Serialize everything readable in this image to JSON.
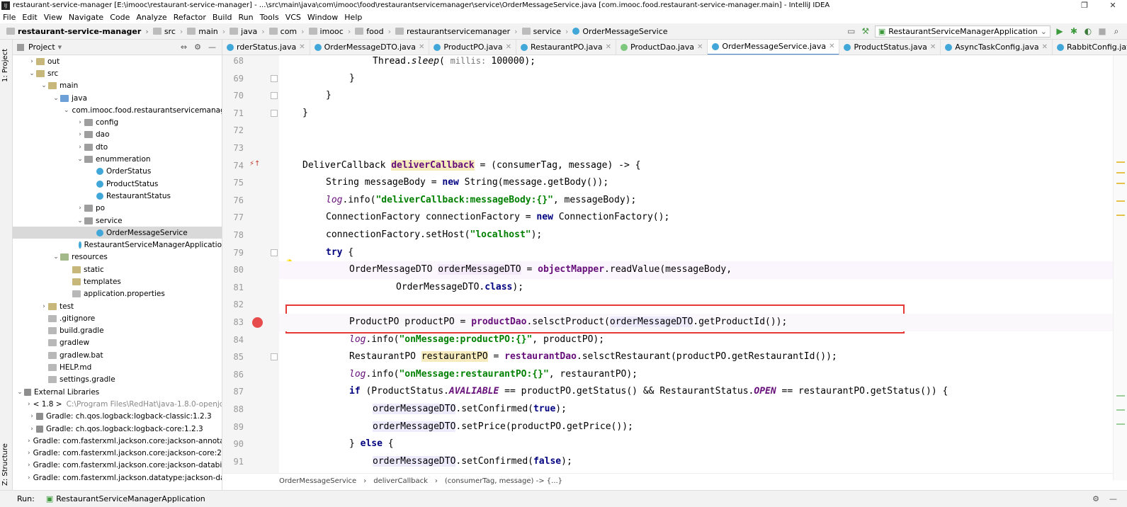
{
  "window": {
    "title": "restaurant-service-manager [E:\\imooc\\restaurant-service-manager] - ...\\src\\main\\java\\com\\imooc\\food\\restaurantservicemanager\\service\\OrderMessageService.java [com.imooc.food.restaurant-service-manager.main] - IntelliJ IDEA"
  },
  "menu": [
    "File",
    "Edit",
    "View",
    "Navigate",
    "Code",
    "Analyze",
    "Refactor",
    "Build",
    "Run",
    "Tools",
    "VCS",
    "Window",
    "Help"
  ],
  "breadcrumb": [
    "restaurant-service-manager",
    "src",
    "main",
    "java",
    "com",
    "imooc",
    "food",
    "restaurantservicemanager",
    "service",
    "OrderMessageService"
  ],
  "run_config": "RestaurantServiceManagerApplication",
  "left_strip": {
    "project": "1: Project",
    "structure": "Z: Structure"
  },
  "project": {
    "title": "Project",
    "tree": [
      {
        "label": "out",
        "arrow": "›",
        "icon": "folder",
        "indent": 1
      },
      {
        "label": "src",
        "arrow": "⌄",
        "icon": "folder",
        "indent": 1
      },
      {
        "label": "main",
        "arrow": "⌄",
        "icon": "folder",
        "indent": 2
      },
      {
        "label": "java",
        "arrow": "⌄",
        "icon": "src",
        "indent": 3
      },
      {
        "label": "com.imooc.food.restaurantservicemanag",
        "arrow": "⌄",
        "icon": "pkg",
        "indent": 4
      },
      {
        "label": "config",
        "arrow": "›",
        "icon": "pkg",
        "indent": 5
      },
      {
        "label": "dao",
        "arrow": "›",
        "icon": "pkg",
        "indent": 5
      },
      {
        "label": "dto",
        "arrow": "›",
        "icon": "pkg",
        "indent": 5
      },
      {
        "label": "enummeration",
        "arrow": "⌄",
        "icon": "pkg",
        "indent": 5
      },
      {
        "label": "OrderStatus",
        "arrow": "",
        "icon": "cls",
        "indent": 6
      },
      {
        "label": "ProductStatus",
        "arrow": "",
        "icon": "cls",
        "indent": 6
      },
      {
        "label": "RestaurantStatus",
        "arrow": "",
        "icon": "cls",
        "indent": 6
      },
      {
        "label": "po",
        "arrow": "›",
        "icon": "pkg",
        "indent": 5
      },
      {
        "label": "service",
        "arrow": "⌄",
        "icon": "pkg",
        "indent": 5
      },
      {
        "label": "OrderMessageService",
        "arrow": "",
        "icon": "cls",
        "indent": 6,
        "selected": true
      },
      {
        "label": "RestaurantServiceManagerApplicatio",
        "arrow": "",
        "icon": "cls",
        "indent": 5
      },
      {
        "label": "resources",
        "arrow": "⌄",
        "icon": "res",
        "indent": 3
      },
      {
        "label": "static",
        "arrow": "",
        "icon": "folder",
        "indent": 4
      },
      {
        "label": "templates",
        "arrow": "",
        "icon": "folder",
        "indent": 4
      },
      {
        "label": "application.properties",
        "arrow": "",
        "icon": "file",
        "indent": 4
      },
      {
        "label": "test",
        "arrow": "›",
        "icon": "folder",
        "indent": 2
      },
      {
        "label": ".gitignore",
        "arrow": "",
        "icon": "file",
        "indent": 2
      },
      {
        "label": "build.gradle",
        "arrow": "",
        "icon": "file",
        "indent": 2
      },
      {
        "label": "gradlew",
        "arrow": "",
        "icon": "file",
        "indent": 2
      },
      {
        "label": "gradlew.bat",
        "arrow": "",
        "icon": "file",
        "indent": 2
      },
      {
        "label": "HELP.md",
        "arrow": "",
        "icon": "file",
        "indent": 2
      },
      {
        "label": "settings.gradle",
        "arrow": "",
        "icon": "file",
        "indent": 2
      },
      {
        "label": "External Libraries",
        "arrow": "⌄",
        "icon": "lib",
        "indent": 0
      },
      {
        "label": "< 1.8 >",
        "dim": "C:\\Program Files\\RedHat\\java-1.8.0-openjd",
        "arrow": "›",
        "icon": "lib",
        "indent": 1
      },
      {
        "label": "Gradle: ch.qos.logback:logback-classic:1.2.3",
        "arrow": "›",
        "icon": "lib",
        "indent": 1
      },
      {
        "label": "Gradle: ch.qos.logback:logback-core:1.2.3",
        "arrow": "›",
        "icon": "lib",
        "indent": 1
      },
      {
        "label": "Gradle: com.fasterxml.jackson.core:jackson-annotat",
        "arrow": "›",
        "icon": "lib",
        "indent": 1
      },
      {
        "label": "Gradle: com.fasterxml.jackson.core:jackson-core:2.1",
        "arrow": "›",
        "icon": "lib",
        "indent": 1
      },
      {
        "label": "Gradle: com.fasterxml.jackson.core:jackson-databin",
        "arrow": "›",
        "icon": "lib",
        "indent": 1
      },
      {
        "label": "Gradle: com.fasterxml.jackson.datatype:jackson-dat",
        "arrow": "›",
        "icon": "lib",
        "indent": 1
      }
    ]
  },
  "tabs": [
    {
      "label": "rderStatus.java",
      "active": false,
      "kind": "class"
    },
    {
      "label": "OrderMessageDTO.java",
      "active": false,
      "kind": "class"
    },
    {
      "label": "ProductPO.java",
      "active": false,
      "kind": "class"
    },
    {
      "label": "RestaurantPO.java",
      "active": false,
      "kind": "class"
    },
    {
      "label": "ProductDao.java",
      "active": false,
      "kind": "iface"
    },
    {
      "label": "OrderMessageService.java",
      "active": true,
      "kind": "class"
    },
    {
      "label": "ProductStatus.java",
      "active": false,
      "kind": "class"
    },
    {
      "label": "AsyncTaskConfig.java",
      "active": false,
      "kind": "class"
    },
    {
      "label": "RabbitConfig.java",
      "active": false,
      "kind": "class"
    }
  ],
  "code": {
    "line_numbers": [
      "68",
      "69",
      "70",
      "71",
      "72",
      "73",
      "74",
      "75",
      "76",
      "77",
      "78",
      "79",
      "80",
      "81",
      "82",
      "83",
      "84",
      "85",
      "86",
      "87",
      "88",
      "89",
      "90",
      "91"
    ],
    "breakpoint_line": "83"
  },
  "bottom_breadcrumb": [
    "OrderMessageService",
    "deliverCallback",
    "(consumerTag, message) -> {...}"
  ],
  "status": {
    "run_label": "Run:",
    "run_tab": "RestaurantServiceManagerApplication"
  }
}
